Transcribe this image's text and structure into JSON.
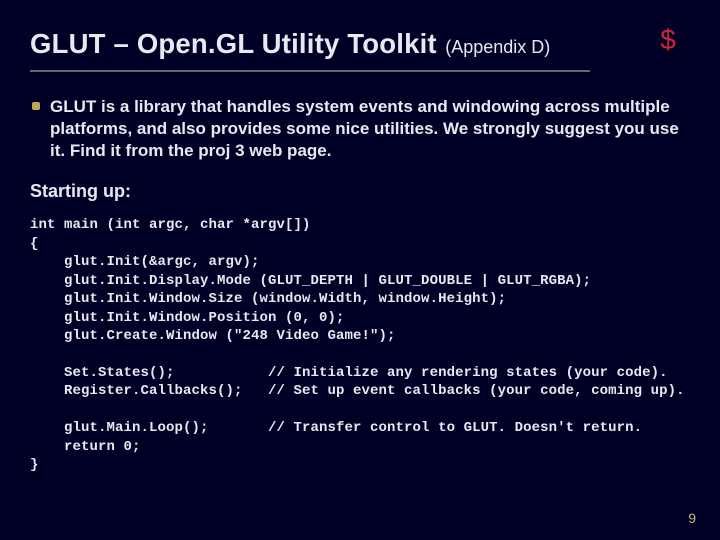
{
  "title": {
    "main": "GLUT – Open.GL Utility Toolkit",
    "sub": "(Appendix D)"
  },
  "logo": {
    "glyph": "$"
  },
  "bullet": {
    "text": "GLUT is a library that handles system events and windowing across multiple platforms, and also provides some nice utilities. We strongly suggest you use it.  Find it from the proj 3 web page."
  },
  "starting_label": "Starting up:",
  "code": "int main (int argc, char *argv[])\n{\n    glut.Init(&argc, argv);\n    glut.Init.Display.Mode (GLUT_DEPTH | GLUT_DOUBLE | GLUT_RGBA);\n    glut.Init.Window.Size (window.Width, window.Height);\n    glut.Init.Window.Position (0, 0);\n    glut.Create.Window (\"248 Video Game!\");\n\n    Set.States();           // Initialize any rendering states (your code).\n    Register.Callbacks();   // Set up event callbacks (your code, coming up).\n\n    glut.Main.Loop();       // Transfer control to GLUT. Doesn't return.\n    return 0;\n}",
  "page_number": "9"
}
